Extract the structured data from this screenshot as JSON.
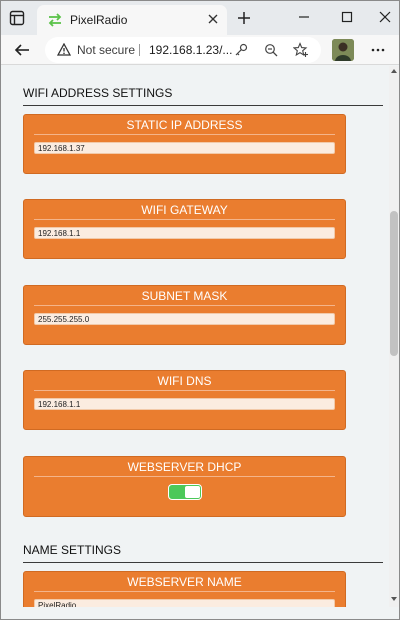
{
  "browser": {
    "tab_title": "PixelRadio",
    "address": {
      "security_label": "Not secure",
      "url": "192.168.1.23/..."
    }
  },
  "sections": [
    {
      "title": "WIFI ADDRESS SETTINGS",
      "cards": [
        {
          "title": "STATIC IP ADDRESS",
          "kind": "input",
          "value": "192.168.1.37"
        },
        {
          "title": "WIFI GATEWAY",
          "kind": "input",
          "value": "192.168.1.1"
        },
        {
          "title": "SUBNET MASK",
          "kind": "input",
          "value": "255.255.255.0"
        },
        {
          "title": "WIFI DNS",
          "kind": "input",
          "value": "192.168.1.1"
        },
        {
          "title": "WEBSERVER DHCP",
          "kind": "toggle",
          "checked": true
        }
      ]
    },
    {
      "title": "NAME SETTINGS",
      "cards": [
        {
          "title": "WEBSERVER NAME",
          "kind": "input",
          "value": "PixelRadio"
        }
      ]
    }
  ],
  "colors": {
    "card_background": "#ea7d2f",
    "toggle_on": "#4cc85a",
    "page_background": "#f0f3f4"
  }
}
